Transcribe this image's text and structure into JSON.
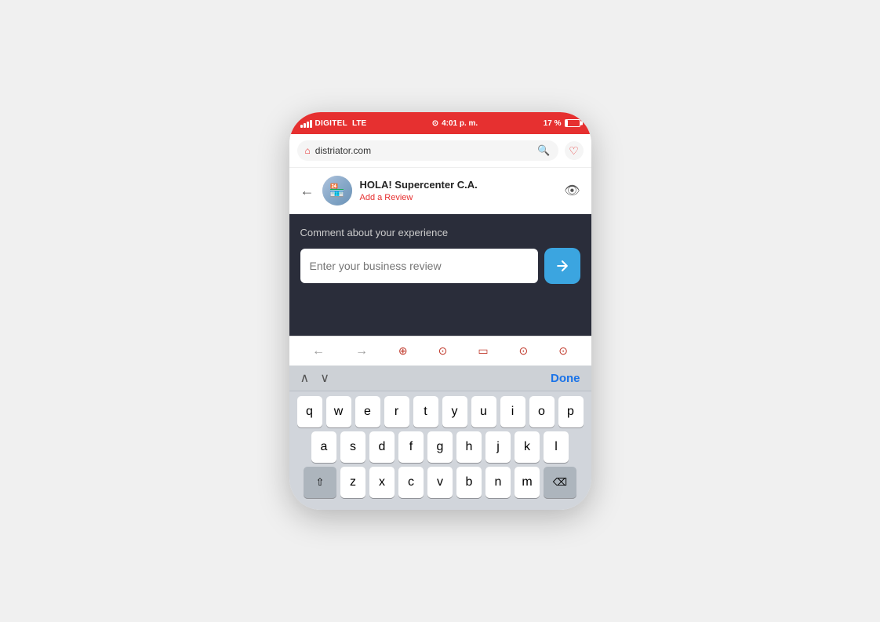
{
  "status_bar": {
    "carrier": "DIGITEL",
    "network": "LTE",
    "time": "4:01 p. m.",
    "battery": "17 %"
  },
  "browser": {
    "url": "distriator.com",
    "search_icon": "🔍",
    "heart_icon": "♡"
  },
  "header": {
    "back_label": "←",
    "business_name": "HOLA! Supercenter C.A.",
    "subtitle": "Add a Review",
    "eye_label": "👁"
  },
  "review": {
    "label": "Comment about your experience",
    "input_placeholder": "Enter your business review",
    "submit_arrow": "→"
  },
  "keyboard_toolbar": {
    "prev": "∧",
    "next": "∨",
    "done": "Done"
  },
  "keyboard": {
    "row1": [
      "q",
      "w",
      "e",
      "r",
      "t",
      "y",
      "u",
      "i",
      "o",
      "p"
    ],
    "row2": [
      "a",
      "s",
      "d",
      "f",
      "g",
      "h",
      "j",
      "k",
      "l"
    ],
    "row3": [
      "z",
      "x",
      "c",
      "v",
      "b",
      "n",
      "m"
    ]
  }
}
